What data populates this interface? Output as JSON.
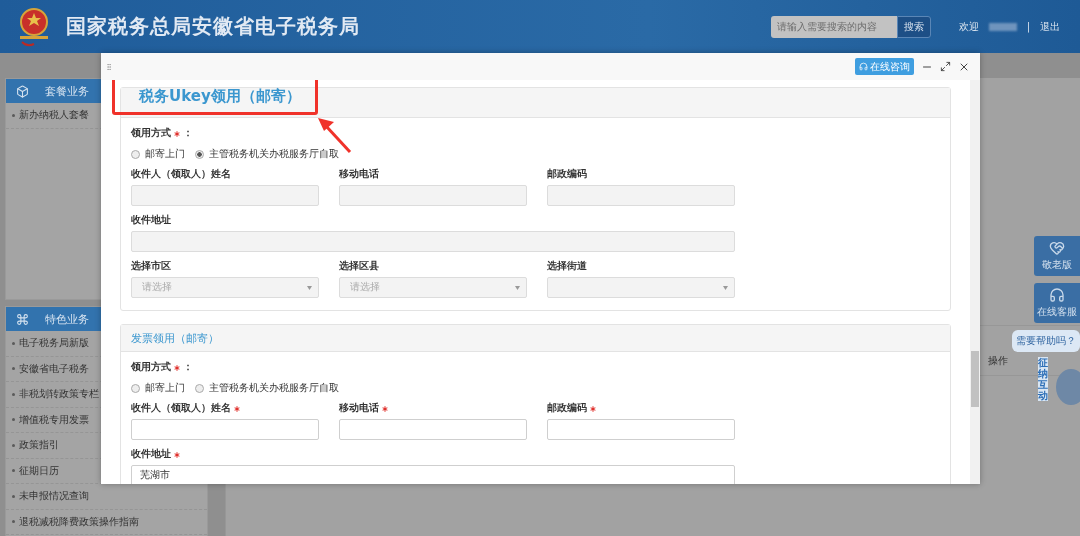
{
  "header": {
    "title": "国家税务总局安徽省电子税务局",
    "search": {
      "placeholder": "请输入需要搜索的内容",
      "button": "搜索"
    },
    "welcome": "欢迎",
    "separator": "|",
    "logout": "退出"
  },
  "sidebar": [
    {
      "title": "套餐业务",
      "items": [
        "新办纳税人套餐"
      ]
    },
    {
      "title": "特色业务",
      "items": [
        "电子税务局新版",
        "安徽省电子税务",
        "非税划转政策专栏",
        "增值税专用发票",
        "政策指引",
        "征期日历",
        "未申报情况查询",
        "退税减税降费政策操作指南"
      ]
    }
  ],
  "content": {
    "table_header": "操作"
  },
  "dock": [
    {
      "label": "敬老版"
    },
    {
      "label": "在线客服"
    }
  ],
  "help_bubble": "需要帮助吗？",
  "mascot": "征纳互动",
  "modal": {
    "consult_button": "在线咨询",
    "sections": [
      {
        "title": "税务Ukey领用（邮寄）",
        "highlighted": true,
        "method": {
          "label": "领用方式",
          "required": true,
          "suffix": "：",
          "options": [
            {
              "label": "邮寄上门",
              "selected": false
            },
            {
              "label": "主管税务机关办税服务厅自取",
              "selected": true
            }
          ]
        },
        "fields": [
          {
            "kind": "input",
            "label": "收件人（领取人）姓名",
            "required": false,
            "disabled": true
          },
          {
            "kind": "input",
            "label": "移动电话",
            "required": false,
            "disabled": true
          },
          {
            "kind": "input",
            "label": "邮政编码",
            "required": false,
            "disabled": true
          },
          {
            "kind": "wide",
            "label": "收件地址",
            "required": false,
            "disabled": true
          },
          {
            "kind": "select",
            "label": "选择市区",
            "required": false,
            "disabled": true,
            "placeholder": "请选择"
          },
          {
            "kind": "select",
            "label": "选择区县",
            "required": false,
            "disabled": true,
            "placeholder": "请选择"
          },
          {
            "kind": "select",
            "label": "选择街道",
            "required": false,
            "disabled": true
          }
        ]
      },
      {
        "title": "发票领用（邮寄）",
        "highlighted": false,
        "method": {
          "label": "领用方式",
          "required": true,
          "suffix": "：",
          "options": [
            {
              "label": "邮寄上门",
              "selected": false
            },
            {
              "label": "主管税务机关办税服务厅自取",
              "selected": false
            }
          ]
        },
        "fields": [
          {
            "kind": "input",
            "label": "收件人（领取人）姓名",
            "required": true,
            "disabled": false
          },
          {
            "kind": "input",
            "label": "移动电话",
            "required": true,
            "disabled": false
          },
          {
            "kind": "input",
            "label": "邮政编码",
            "required": true,
            "disabled": false
          },
          {
            "kind": "wide",
            "label": "收件地址",
            "required": true,
            "disabled": false,
            "value": "芜湖市"
          }
        ]
      }
    ]
  }
}
